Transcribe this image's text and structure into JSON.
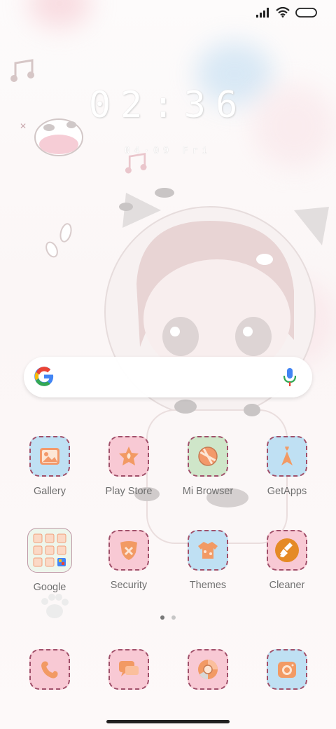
{
  "colors": {
    "accent": "#a0506a",
    "label": "#6f6f6f",
    "icon_blue": "#bfe0f3",
    "icon_pink": "#f8c9d4",
    "icon_green": "#cfe6c9"
  },
  "status_bar": {
    "icons": [
      "signal-icon",
      "wifi-icon",
      "battery-icon"
    ]
  },
  "clock": {
    "time": "02:36",
    "date": "04·09 Fri"
  },
  "search_bar": {
    "icons": [
      "google-logo-icon",
      "microphone-icon"
    ]
  },
  "apps": [
    {
      "label": "Gallery",
      "icon": "gallery-icon"
    },
    {
      "label": "Play Store",
      "icon": "play-store-icon"
    },
    {
      "label": "Mi Browser",
      "icon": "mi-browser-icon"
    },
    {
      "label": "GetApps",
      "icon": "getapps-icon"
    },
    {
      "label": "Google",
      "icon": "google-folder-icon"
    },
    {
      "label": "Security",
      "icon": "security-icon"
    },
    {
      "label": "Themes",
      "icon": "themes-icon"
    },
    {
      "label": "Cleaner",
      "icon": "cleaner-icon"
    }
  ],
  "dock": [
    {
      "icon": "phone-icon"
    },
    {
      "icon": "messages-icon"
    },
    {
      "icon": "chrome-icon"
    },
    {
      "icon": "camera-icon"
    }
  ],
  "page_indicator": {
    "pages": 2,
    "current": 1
  }
}
